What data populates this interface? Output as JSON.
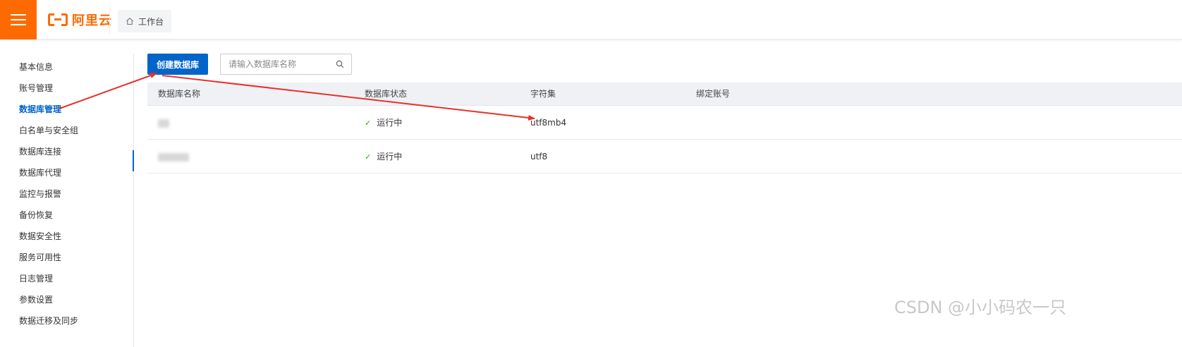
{
  "header": {
    "logo_text": "阿里云",
    "workbench_label": "工作台"
  },
  "sidebar": {
    "items": [
      {
        "label": "基本信息",
        "active": false
      },
      {
        "label": "账号管理",
        "active": false
      },
      {
        "label": "数据库管理",
        "active": true
      },
      {
        "label": "白名单与安全组",
        "active": false
      },
      {
        "label": "数据库连接",
        "active": false
      },
      {
        "label": "数据库代理",
        "active": false
      },
      {
        "label": "监控与报警",
        "active": false
      },
      {
        "label": "备份恢复",
        "active": false
      },
      {
        "label": "数据安全性",
        "active": false
      },
      {
        "label": "服务可用性",
        "active": false
      },
      {
        "label": "日志管理",
        "active": false
      },
      {
        "label": "参数设置",
        "active": false
      },
      {
        "label": "数据迁移及同步",
        "active": false
      }
    ]
  },
  "toolbar": {
    "create_label": "创建数据库",
    "search_placeholder": "请输入数据库名称"
  },
  "table": {
    "columns": [
      "数据库名称",
      "数据库状态",
      "字符集",
      "绑定账号"
    ],
    "rows": [
      {
        "name": "",
        "status": "运行中",
        "charset": "utf8mb4",
        "account": ""
      },
      {
        "name": "",
        "status": "运行中",
        "charset": "utf8",
        "account": ""
      }
    ]
  },
  "colors": {
    "brand_orange": "#ff6a00",
    "primary_blue": "#0064c8",
    "annotation_red": "#e8312a",
    "success_green": "#2aa515"
  },
  "watermark": "CSDN @小小码农一只"
}
